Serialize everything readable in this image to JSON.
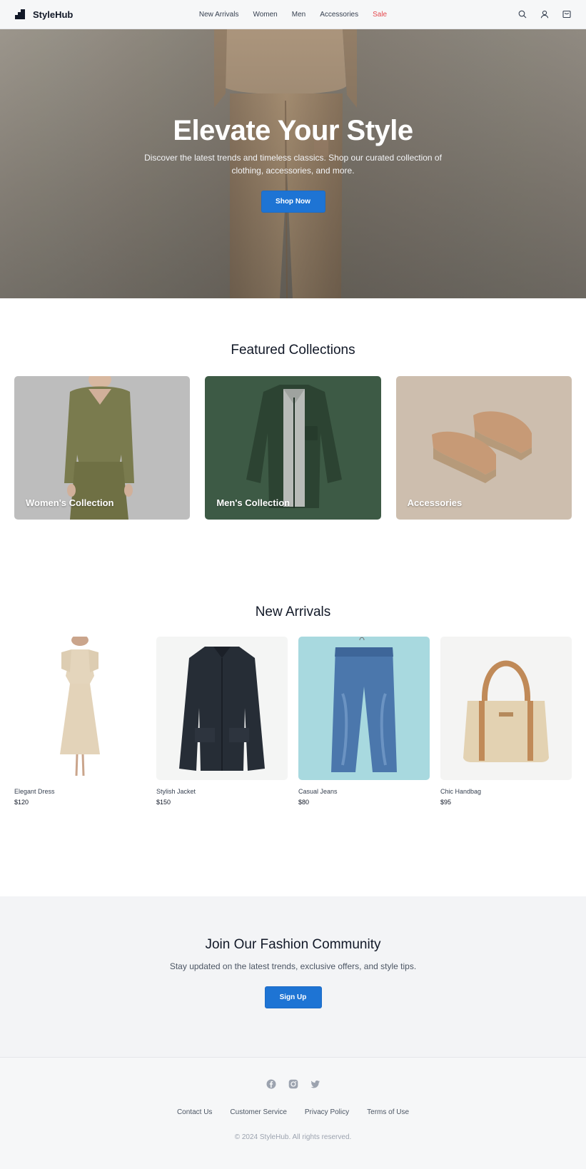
{
  "header": {
    "brand": "StyleHub",
    "nav": [
      {
        "label": "New Arrivals"
      },
      {
        "label": "Women"
      },
      {
        "label": "Men"
      },
      {
        "label": "Accessories"
      },
      {
        "label": "Sale"
      }
    ],
    "icons": [
      "search-icon",
      "user-icon",
      "cart-icon"
    ]
  },
  "hero": {
    "title": "Elevate Your Style",
    "subtitle": "Discover the latest trends and timeless classics. Shop our curated collection of clothing, accessories, and more.",
    "cta": "Shop Now"
  },
  "featured": {
    "title": "Featured Collections",
    "collections": [
      {
        "label": "Women's Collection"
      },
      {
        "label": "Men's Collection"
      },
      {
        "label": "Accessories"
      }
    ]
  },
  "arrivals": {
    "title": "New Arrivals",
    "products": [
      {
        "name": "Elegant Dress",
        "price": "$120"
      },
      {
        "name": "Stylish Jacket",
        "price": "$150"
      },
      {
        "name": "Casual Jeans",
        "price": "$80"
      },
      {
        "name": "Chic Handbag",
        "price": "$95"
      }
    ]
  },
  "community": {
    "title": "Join Our Fashion Community",
    "subtitle": "Stay updated on the latest trends, exclusive offers, and style tips.",
    "cta": "Sign Up"
  },
  "footer": {
    "socials": [
      "facebook-icon",
      "instagram-icon",
      "twitter-icon"
    ],
    "links": [
      {
        "label": "Contact Us"
      },
      {
        "label": "Customer Service"
      },
      {
        "label": "Privacy Policy"
      },
      {
        "label": "Terms of Use"
      }
    ],
    "copyright": "© 2024 StyleHub. All rights reserved."
  },
  "colors": {
    "accent": "#1e74d4",
    "sale": "#e5484d",
    "header_bg": "#f6f7f8",
    "community_bg": "#f3f4f6"
  }
}
